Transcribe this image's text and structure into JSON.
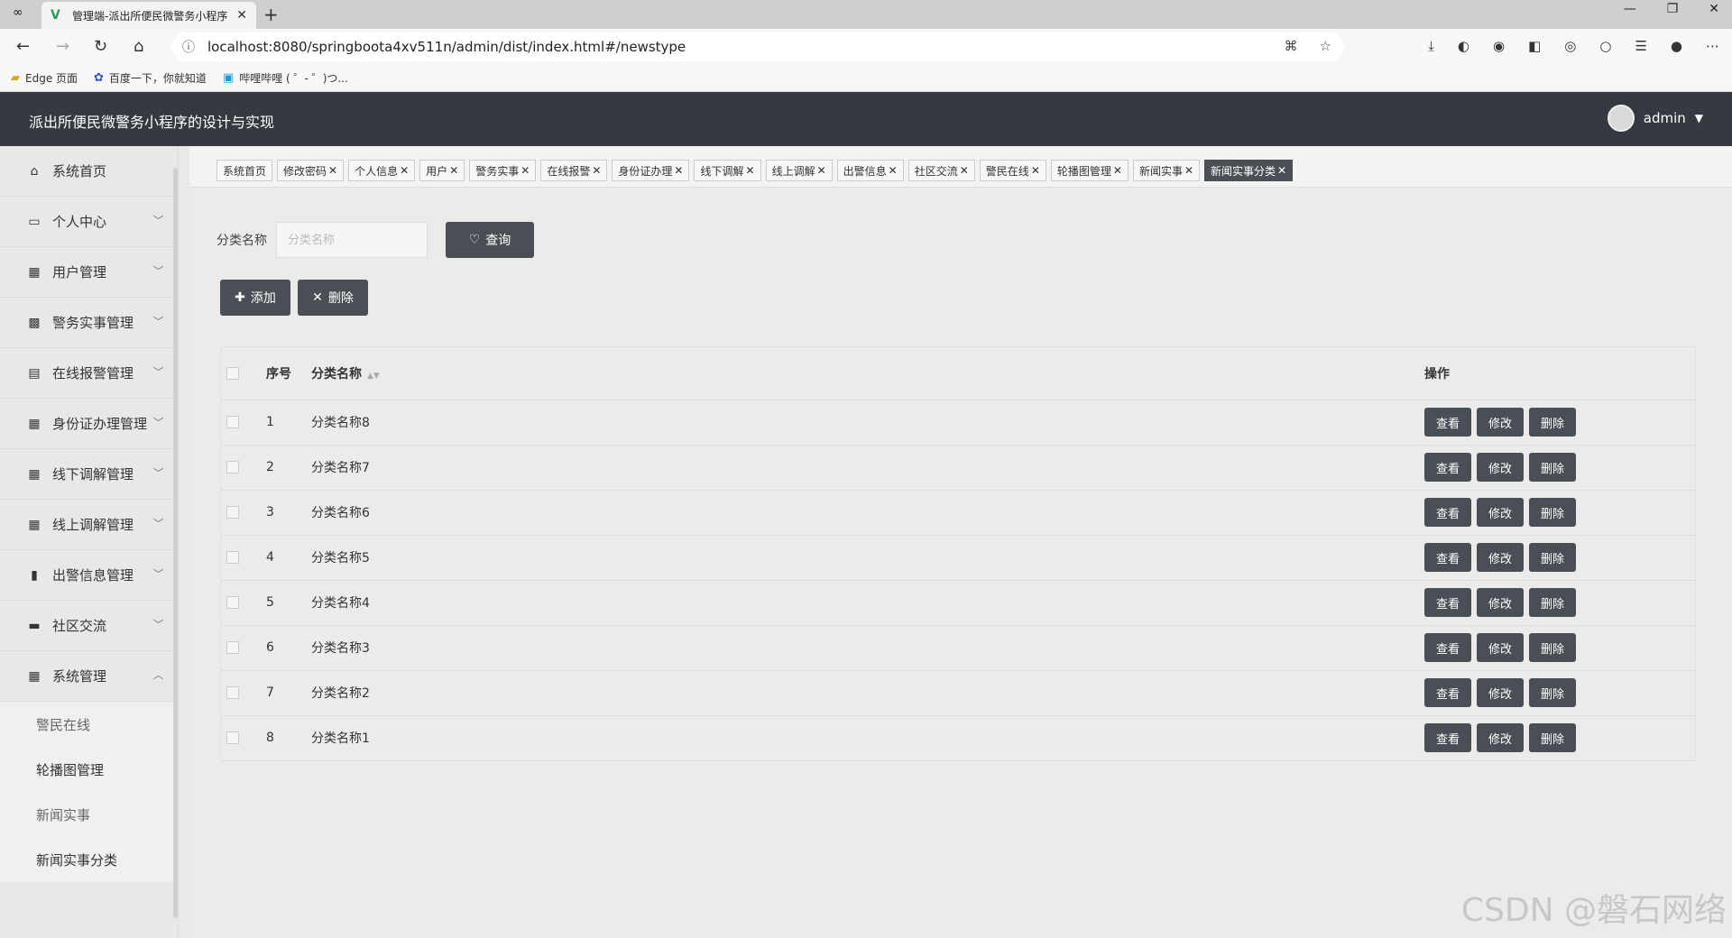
{
  "browser": {
    "tab_title": "管理端-派出所便民微警务小程序",
    "url": "localhost:8080/springboota4xv511n/admin/dist/index.html#/newstype",
    "bookmarks": [
      "Edge 页面",
      "百度一下，你就知道",
      "哔哩哔哩 ( ゜- ゜)つ..."
    ]
  },
  "header": {
    "title": "派出所便民微警务小程序的设计与实现",
    "username": "admin"
  },
  "sidebar": {
    "items": [
      {
        "label": "系统首页",
        "icon": "home-icon"
      },
      {
        "label": "个人中心",
        "icon": "id-card-icon"
      },
      {
        "label": "用户管理",
        "icon": "grid-icon"
      },
      {
        "label": "警务实事管理",
        "icon": "clipboard-x-icon"
      },
      {
        "label": "在线报警管理",
        "icon": "clipboard-icon"
      },
      {
        "label": "身份证办理管理",
        "icon": "grid-9-icon"
      },
      {
        "label": "线下调解管理",
        "icon": "grid-icon"
      },
      {
        "label": "线上调解管理",
        "icon": "grid-icon"
      },
      {
        "label": "出警信息管理",
        "icon": "bar-chart-icon"
      },
      {
        "label": "社区交流",
        "icon": "ticket-icon"
      },
      {
        "label": "系统管理",
        "icon": "grid-icon"
      }
    ],
    "subitems": [
      "警民在线",
      "轮播图管理",
      "新闻实事",
      "新闻实事分类"
    ]
  },
  "tags": [
    "系统首页",
    "修改密码",
    "个人信息",
    "用户",
    "警务实事",
    "在线报警",
    "身份证办理",
    "线下调解",
    "线上调解",
    "出警信息",
    "社区交流",
    "警民在线",
    "轮播图管理",
    "新闻实事",
    "新闻实事分类"
  ],
  "search": {
    "label": "分类名称",
    "placeholder": "分类名称",
    "button": "查询"
  },
  "actions": {
    "add": "添加",
    "delete": "删除"
  },
  "table": {
    "headers": {
      "index": "序号",
      "name": "分类名称",
      "ops": "操作"
    },
    "rows": [
      {
        "index": "1",
        "name": "分类名称8"
      },
      {
        "index": "2",
        "name": "分类名称7"
      },
      {
        "index": "3",
        "name": "分类名称6"
      },
      {
        "index": "4",
        "name": "分类名称5"
      },
      {
        "index": "5",
        "name": "分类名称4"
      },
      {
        "index": "6",
        "name": "分类名称3"
      },
      {
        "index": "7",
        "name": "分类名称2"
      },
      {
        "index": "8",
        "name": "分类名称1"
      }
    ],
    "ops": {
      "view": "查看",
      "edit": "修改",
      "delete": "删除"
    }
  },
  "watermark": "CSDN @磐石网络"
}
